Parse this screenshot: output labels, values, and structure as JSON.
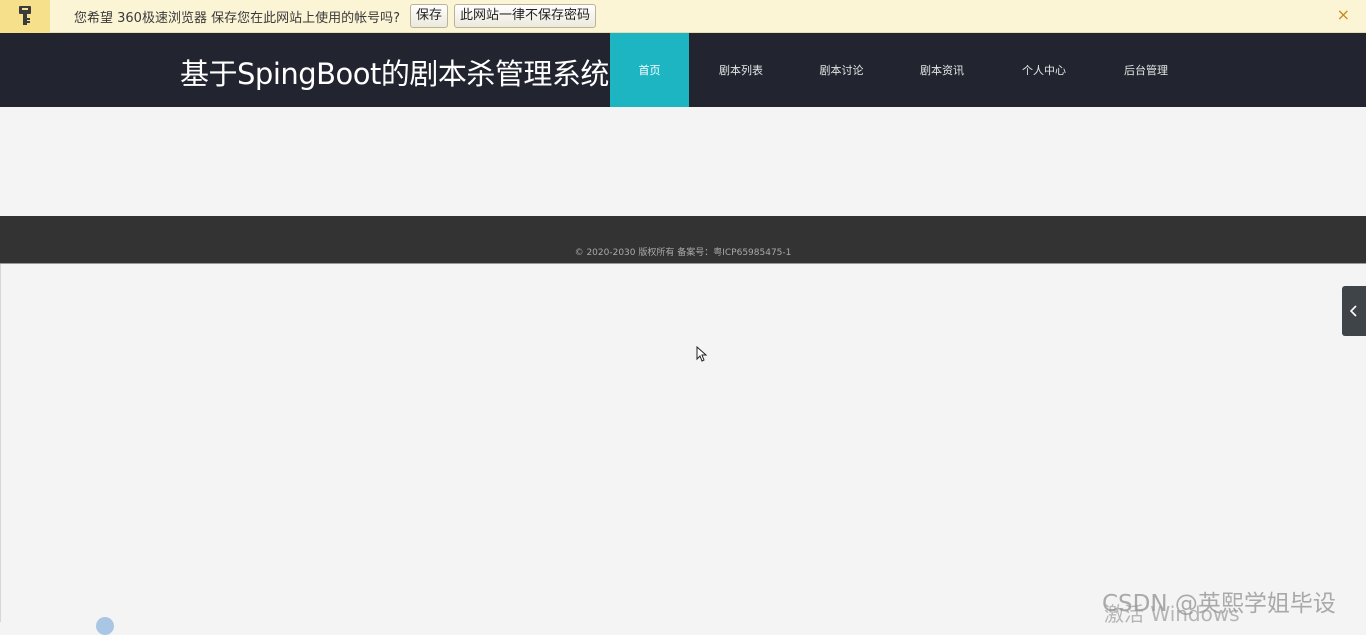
{
  "password_bar": {
    "icon": "key-icon",
    "message": "您希望 360极速浏览器 保存您在此网站上使用的帐号吗?",
    "save_label": "保存",
    "never_label": "此网站一律不保存密码",
    "close_glyph": "×"
  },
  "header": {
    "title": "基于SpingBoot的剧本杀管理系统",
    "nav": [
      {
        "label": "首页",
        "active": true
      },
      {
        "label": "剧本列表",
        "active": false
      },
      {
        "label": "剧本讨论",
        "active": false
      },
      {
        "label": "剧本资讯",
        "active": false
      },
      {
        "label": "个人中心",
        "active": false
      },
      {
        "label": "后台管理",
        "active": false
      }
    ]
  },
  "footer": {
    "copyright": "© 2020-2030 版权所有 备案号：粤ICP65985475-1"
  },
  "side_toggle": {
    "icon": "chevron-left-icon"
  },
  "watermarks": {
    "windows": "激活 Windows",
    "csdn": "CSDN @英熙学姐毕设"
  },
  "colors": {
    "header_bg": "#222530",
    "nav_active": "#1eb5c2",
    "footer_bg": "#333333",
    "bar_bg": "#fbf5d6"
  }
}
